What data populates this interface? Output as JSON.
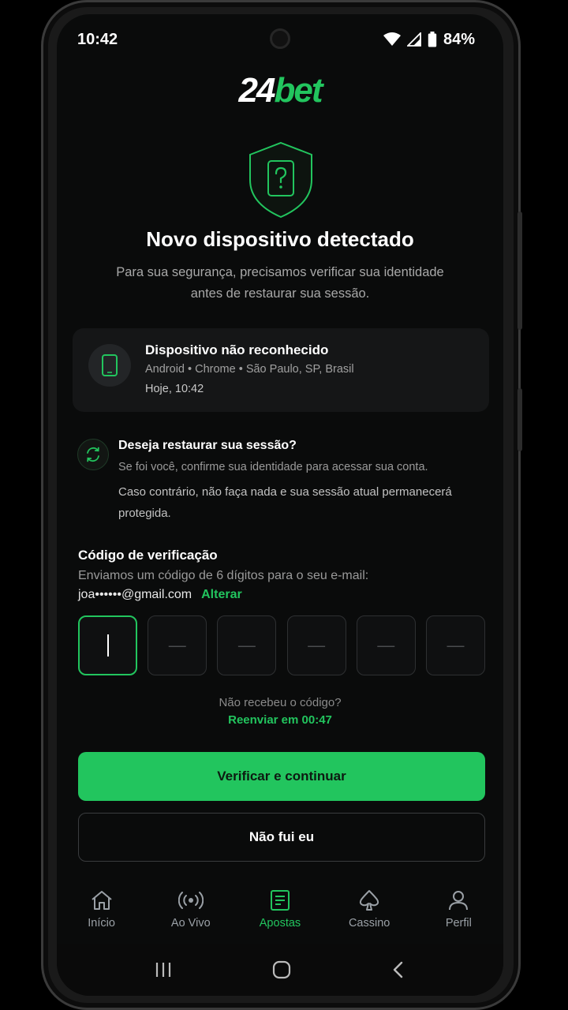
{
  "status_bar": {
    "time": "10:42",
    "battery": "84%"
  },
  "brand": {
    "number": "24",
    "word": "bet",
    "accent": "#22c55e"
  },
  "header": {
    "title": "Novo dispositivo detectado",
    "subtitle": "Para sua segurança, precisamos verificar sua identidade antes de restaurar sua sessão."
  },
  "device": {
    "title": "Dispositivo não reconhecido",
    "meta": "Android • Chrome • São Paulo, SP, Brasil",
    "time": "Hoje, 10:42"
  },
  "restore": {
    "title": "Deseja restaurar sua sessão?",
    "line1": "Se foi você, confirme sua identidade para acessar sua conta.",
    "line2": "Caso contrário, não faça nada e sua sessão atual permanecerá protegida."
  },
  "verification": {
    "label": "Código de verificação",
    "hint": "Enviamos um código de 6 dígitos para o seu e-mail:",
    "email": "joa••••••@gmail.com",
    "change_label": "Alterar",
    "placeholder": "—"
  },
  "resend": {
    "question": "Não recebeu o código?",
    "timer": "Reenviar em 00:47"
  },
  "actions": {
    "primary": "Verificar e continuar",
    "secondary": "Não fui eu"
  },
  "tabs": [
    {
      "label": "Início",
      "icon": "home-icon"
    },
    {
      "label": "Ao Vivo",
      "icon": "live-icon"
    },
    {
      "label": "Apostas",
      "icon": "bets-icon",
      "active": true
    },
    {
      "label": "Cassino",
      "icon": "spade-icon"
    },
    {
      "label": "Perfil",
      "icon": "profile-icon"
    }
  ]
}
